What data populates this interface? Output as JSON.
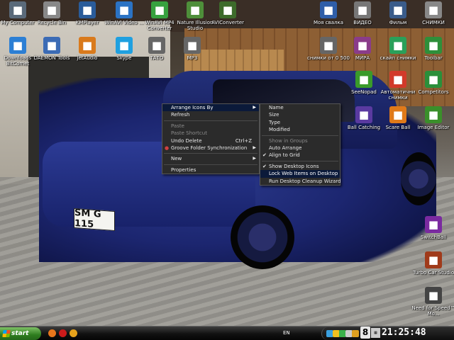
{
  "desktop_icons": [
    {
      "label": "My Computer",
      "icon": "computer-icon",
      "color": "#5a6a7a"
    },
    {
      "label": "Recycle Bin",
      "icon": "recycle-bin-icon",
      "color": "#888888"
    },
    {
      "label": "KMPlayer",
      "icon": "kmplayer-icon",
      "color": "#2a5c9a"
    },
    {
      "label": "WinAVI Video ...",
      "icon": "winavi-icon",
      "color": "#2b73c4"
    },
    {
      "label": "WinAVI MP4 Converter",
      "icon": "winavi-mp4-icon",
      "color": "#37a13f"
    },
    {
      "label": "Nature Illusion Studio",
      "icon": "nature-illusion-icon",
      "color": "#4e8f3a"
    },
    {
      "label": "AVIConverter",
      "icon": "aviconverter-icon",
      "color": "#3d6b2b"
    },
    {
      "label": "Моя свалка",
      "icon": "folder-icon",
      "color": "#2f5ea8"
    },
    {
      "label": "ВИДЕО",
      "icon": "video-folder-icon",
      "color": "#777777"
    },
    {
      "label": "Фильм",
      "icon": "film-icon",
      "color": "#3a5c8a"
    },
    {
      "label": "СНИМКИ",
      "icon": "camera-icon",
      "color": "#888888"
    },
    {
      "label": "Downloads BitComet",
      "icon": "bitcomet-icon",
      "color": "#2c7fd4"
    },
    {
      "label": "DAEMON Tools",
      "icon": "daemon-tools-icon",
      "color": "#3b6bb5"
    },
    {
      "label": "jetAudio",
      "icon": "jetaudio-icon",
      "color": "#d97a1c"
    },
    {
      "label": "Skype",
      "icon": "skype-icon",
      "color": "#1fa0e0"
    },
    {
      "label": "ТАТО",
      "icon": "document-icon",
      "color": "#666666"
    },
    {
      "label": "MP3",
      "icon": "mp3-folder-icon",
      "color": "#666666"
    },
    {
      "label": "снимки от 0 500",
      "icon": "photos-icon",
      "color": "#666666"
    },
    {
      "label": "МИРА",
      "icon": "mira-icon",
      "color": "#8a3c8a"
    },
    {
      "label": "скайп снимки",
      "icon": "skype-photos-icon",
      "color": "#2aa05a"
    },
    {
      "label": "Toolbar",
      "icon": "toolbar-icon",
      "color": "#2e8f3a"
    },
    {
      "label": "SeeNopad",
      "icon": "seenopad-icon",
      "color": "#3a9a2a"
    },
    {
      "label": "Автоматични снимки",
      "icon": "users-icon",
      "color": "#d23a2a"
    },
    {
      "label": "Competitors",
      "icon": "competitors-icon",
      "color": "#2a8f3a"
    },
    {
      "label": "Ball Catching",
      "icon": "ball-catching-icon",
      "color": "#5a3aa0"
    },
    {
      "label": "Scare Ball",
      "icon": "scare-ball-icon",
      "color": "#e07a1a"
    },
    {
      "label": "Image Editor",
      "icon": "image-editor-icon",
      "color": "#3a8f2a"
    },
    {
      "label": "SwitchBall",
      "icon": "switchball-icon",
      "color": "#7a2aa0"
    },
    {
      "label": "Turbo Car Studio",
      "icon": "turbo-car-icon",
      "color": "#a03a1a"
    },
    {
      "label": "Need for Speed™ Mo...",
      "icon": "nfs-icon",
      "color": "#444444"
    }
  ],
  "wallpaper": {
    "plate_text": "SM G 115"
  },
  "context_menu": {
    "items": [
      {
        "label": "Arrange Icons By",
        "type": "submenu",
        "highlighted": true
      },
      {
        "label": "Refresh"
      },
      {
        "type": "separator"
      },
      {
        "label": "Paste",
        "disabled": true
      },
      {
        "label": "Paste Shortcut",
        "disabled": true
      },
      {
        "label": "Undo Delete",
        "shortcut": "Ctrl+Z"
      },
      {
        "label": "Groove Folder Synchronization",
        "type": "submenu",
        "icon": "groove-icon"
      },
      {
        "type": "separator"
      },
      {
        "label": "New",
        "type": "submenu"
      },
      {
        "type": "separator"
      },
      {
        "label": "Properties"
      }
    ]
  },
  "submenu": {
    "items": [
      {
        "label": "Name"
      },
      {
        "label": "Size"
      },
      {
        "label": "Type"
      },
      {
        "label": "Modified"
      },
      {
        "type": "separator"
      },
      {
        "label": "Show in Groups",
        "disabled": true
      },
      {
        "label": "Auto Arrange"
      },
      {
        "label": "Align to Grid",
        "checked": true
      },
      {
        "type": "separator"
      },
      {
        "label": "Show Desktop Icons",
        "checked": true
      },
      {
        "label": "Lock Web Items on Desktop",
        "highlighted": true
      },
      {
        "label": "Run Desktop Cleanup Wizard"
      }
    ]
  },
  "taskbar": {
    "start_label": "start",
    "language": "EN",
    "date_day": "8",
    "time": "21:25:48",
    "quick_launch": [
      {
        "icon": "firefox-icon",
        "color": "#e8761c"
      },
      {
        "icon": "opera-icon",
        "color": "#cc1b1b"
      },
      {
        "icon": "desktop-icon",
        "color": "#e8a31c"
      }
    ],
    "tray": [
      {
        "icon": "tray-shield-icon",
        "color": "#3aa0e0"
      },
      {
        "icon": "tray-smiley-icon",
        "color": "#f0c020"
      },
      {
        "icon": "tray-network-icon",
        "color": "#3ab04a"
      },
      {
        "icon": "tray-volume-icon",
        "color": "#cccccc"
      },
      {
        "icon": "tray-update-icon",
        "color": "#e0a020"
      }
    ]
  }
}
